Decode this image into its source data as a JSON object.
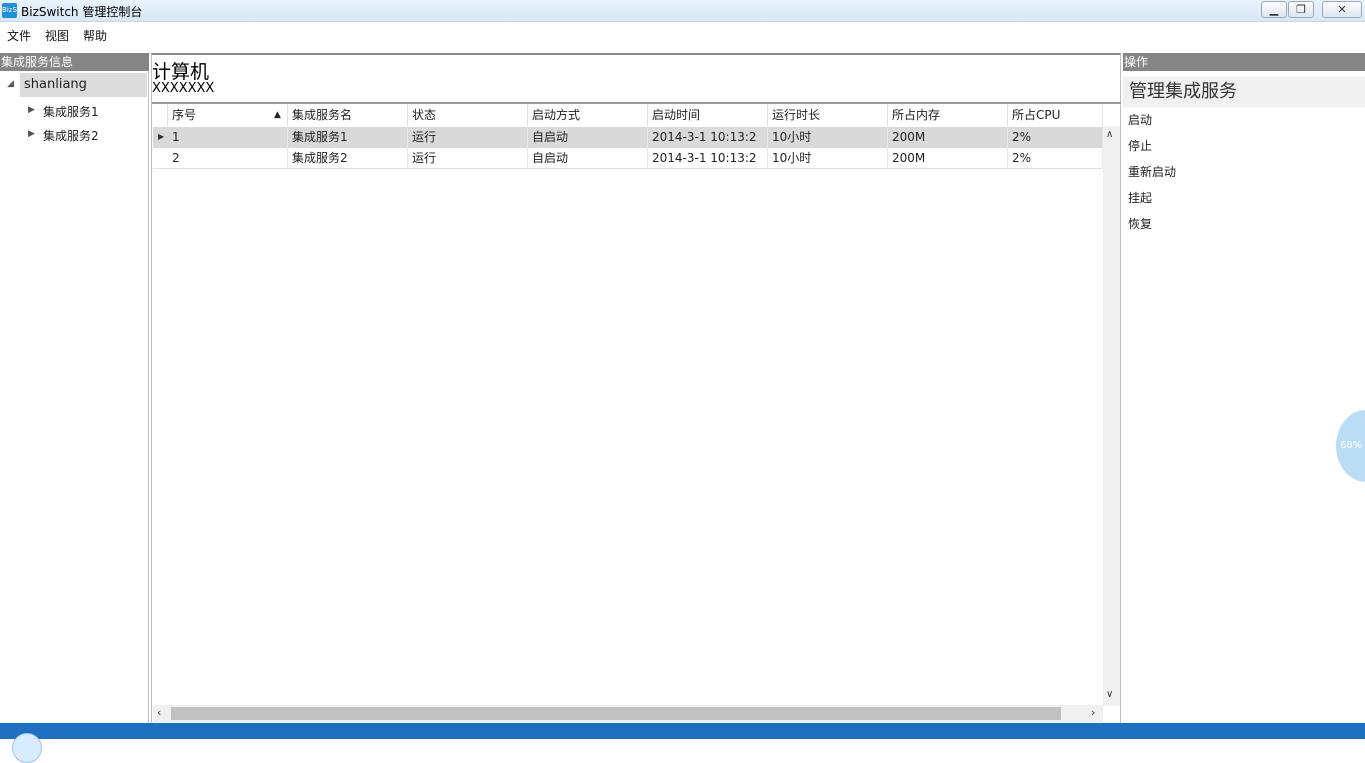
{
  "window": {
    "title": "BizSwitch 管理控制台",
    "app_icon_text": "BizS",
    "minimize_icon": "minimize-icon",
    "maximize_icon": "restore-icon",
    "close_icon": "close-icon"
  },
  "menu": [
    "文件",
    "视图",
    "帮助"
  ],
  "left": {
    "header": "集成服务信息",
    "root": "shanliang",
    "children": [
      "集成服务1",
      "集成服务2"
    ]
  },
  "main": {
    "title": "计算机",
    "subtitle": "XXXXXXX",
    "columns": [
      "序号",
      "集成服务名",
      "状态",
      "启动方式",
      "启动时间",
      "运行时长",
      "所占内存",
      "所占CPU"
    ],
    "rows": [
      [
        "1",
        "集成服务1",
        "运行",
        "自启动",
        "2014-3-1 10:13:2",
        "10小时",
        "200M",
        "2%"
      ],
      [
        "2",
        "集成服务2",
        "运行",
        "自启动",
        "2014-3-1 10:13:2",
        "10小时",
        "200M",
        "2%"
      ]
    ]
  },
  "right": {
    "header": "操作",
    "group_title": "管理集成服务",
    "actions": [
      "启动",
      "停止",
      "重新启动",
      "挂起",
      "恢复"
    ]
  },
  "overlay": {
    "percent": "68%"
  },
  "colors": {
    "header_gray": "#858585",
    "taskbar_blue": "#1f6fc1",
    "selected_row": "#d9d9d9"
  }
}
